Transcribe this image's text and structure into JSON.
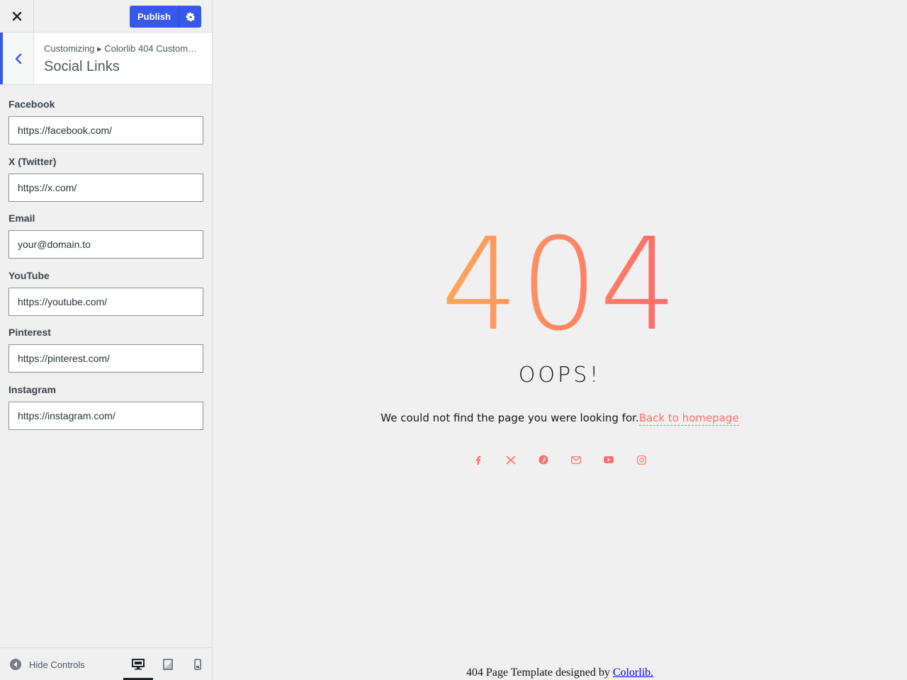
{
  "topbar": {
    "close_icon": "close-icon",
    "publish_label": "Publish",
    "settings_icon": "gear-icon",
    "accent": "#3858e9"
  },
  "section": {
    "breadcrumb": "Customizing ▸ Colorlib 404 Custom…",
    "title": "Social Links"
  },
  "controls": [
    {
      "label": "Facebook",
      "value": "https://facebook.com/"
    },
    {
      "label": "X (Twitter)",
      "value": "https://x.com/"
    },
    {
      "label": "Email",
      "value": "your@domain.to"
    },
    {
      "label": "YouTube",
      "value": "https://youtube.com/"
    },
    {
      "label": "Pinterest",
      "value": "https://pinterest.com/"
    },
    {
      "label": "Instagram",
      "value": "https://instagram.com/"
    }
  ],
  "footer": {
    "hide_controls_label": "Hide Controls",
    "devices": [
      "desktop-icon",
      "tablet-icon",
      "mobile-icon"
    ],
    "active_device": "desktop"
  },
  "preview": {
    "code": "404",
    "heading": "OOPS!",
    "message": "We could not find the page you were looking for.",
    "home_link": "Back to homepage",
    "social_icons": [
      "facebook-icon",
      "x-icon",
      "pinterest-icon",
      "email-icon",
      "youtube-icon",
      "instagram-icon"
    ],
    "credit_text": "404 Page Template designed by ",
    "credit_link": "Colorlib.",
    "gradient": [
      "#fda35b",
      "#fd6e6a"
    ]
  }
}
